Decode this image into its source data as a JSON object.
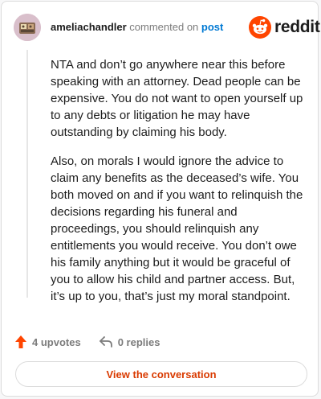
{
  "header": {
    "username": "ameliachandler",
    "commented_text": "commented on",
    "post_link": "post",
    "brand": "reddit"
  },
  "comment": {
    "paragraphs": [
      "NTA and don’t go anywhere near this before speaking with an attorney. Dead people can be expensive. You do not want to open yourself up to any debts or litigation he may have outstanding by claiming his body.",
      "Also, on morals I would ignore the advice to claim any benefits as the deceased’s wife. You both moved on and if you want to relinquish the decisions regarding his funeral and proceedings, you should relinquish any entitlements you would receive. You don’t owe his family anything but it would be graceful of you to allow his child and partner access. But, it’s up to you, that’s just my moral standpoint."
    ]
  },
  "actions": {
    "upvotes": "4 upvotes",
    "replies": "0 replies"
  },
  "footer": {
    "view_button": "View the conversation"
  },
  "colors": {
    "brand_orange": "#ff4500",
    "link_blue": "#0079d3",
    "button_text": "#d93a00",
    "muted": "#7c7c7c"
  },
  "icons": {
    "avatar": "avatar-image",
    "logo": "reddit-snoo-icon",
    "upvote": "upvote-arrow-icon",
    "reply": "reply-arrow-icon"
  }
}
